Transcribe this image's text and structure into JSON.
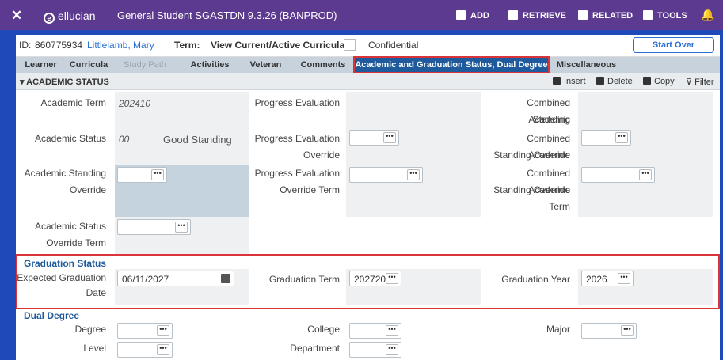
{
  "topbar": {
    "close": "✕",
    "logo": "ellucian",
    "title": "General Student SGASTDN 9.3.26 (BANPROD)",
    "add": "ADD",
    "retrieve": "RETRIEVE",
    "related": "RELATED",
    "tools": "TOOLS"
  },
  "info": {
    "id_label": "ID:",
    "id_value": "860775934",
    "name": "Littlelamb, Mary",
    "term_label": "Term:",
    "curricula_label": "View Current/Active Curricula:",
    "confidential": "Confidential",
    "start_over": "Start Over"
  },
  "tabs": [
    "Learner",
    "Curricula",
    "Study Path",
    "Activities",
    "Veteran",
    "Comments",
    "Academic and Graduation Status, Dual Degree",
    "Miscellaneous"
  ],
  "section": {
    "title": "ACADEMIC STATUS",
    "insert": "Insert",
    "delete": "Delete",
    "copy": "Copy",
    "filter": "Filter"
  },
  "academic": {
    "term_label": "Academic Term",
    "term_value": "202410",
    "status_label": "Academic Status",
    "status_code": "00",
    "status_desc": "Good Standing",
    "standing_override_label1": "Academic Standing",
    "standing_override_label2": "Override",
    "status_override_term_label1": "Academic Status",
    "status_override_term_label2": "Override Term",
    "progress_eval_label": "Progress Evaluation",
    "progress_override_label1": "Progress Evaluation",
    "progress_override_label2": "Override",
    "progress_override_term_label1": "Progress Evaluation",
    "progress_override_term_label2": "Override Term",
    "combined_label1": "Combined Academic",
    "combined_label2": "Standing",
    "combined_override_label1": "Combined Academic",
    "combined_override_label2": "Standing Override",
    "combined_override_term_label1": "Combined Academic",
    "combined_override_term_label2": "Standing Override",
    "combined_override_term_label3": "Term"
  },
  "graduation": {
    "heading": "Graduation Status",
    "expected_label1": "Expected Graduation",
    "expected_label2": "Date",
    "expected_value": "06/11/2027",
    "term_label": "Graduation Term",
    "term_value": "202720",
    "year_label": "Graduation Year",
    "year_value": "2026"
  },
  "dual": {
    "heading": "Dual Degree",
    "degree": "Degree",
    "college": "College",
    "major": "Major",
    "level": "Level",
    "department": "Department"
  }
}
